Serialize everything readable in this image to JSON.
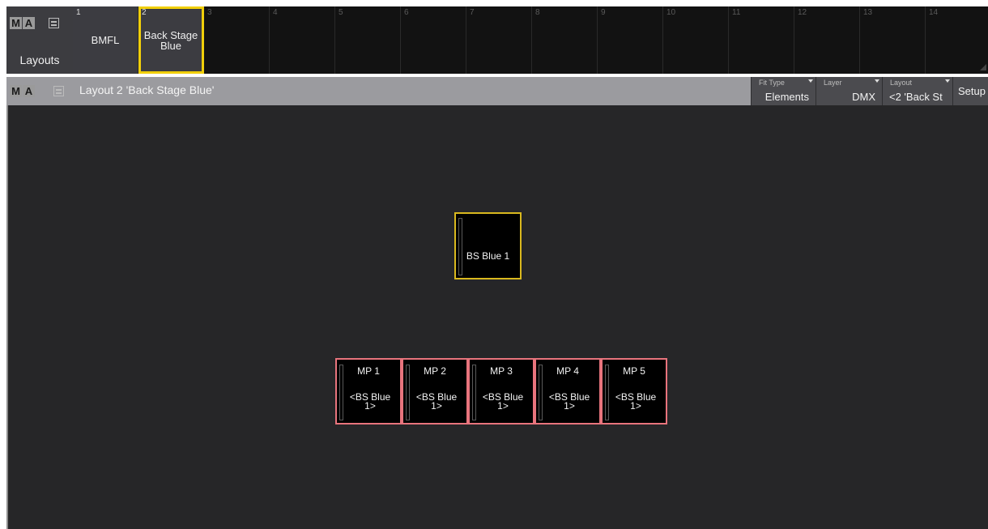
{
  "pool": {
    "title": "Layouts",
    "logo_letters": [
      "M",
      "A"
    ],
    "slots": [
      {
        "num": "1",
        "label": "BMFL"
      },
      {
        "num": "2",
        "label": "Back Stage\nBlue"
      },
      {
        "num": "3",
        "label": ""
      },
      {
        "num": "4",
        "label": ""
      },
      {
        "num": "5",
        "label": ""
      },
      {
        "num": "6",
        "label": ""
      },
      {
        "num": "7",
        "label": ""
      },
      {
        "num": "8",
        "label": ""
      },
      {
        "num": "9",
        "label": ""
      },
      {
        "num": "10",
        "label": ""
      },
      {
        "num": "11",
        "label": ""
      },
      {
        "num": "12",
        "label": ""
      },
      {
        "num": "13",
        "label": ""
      },
      {
        "num": "14",
        "label": ""
      }
    ],
    "selected_slot": "2"
  },
  "window": {
    "logo_letters": [
      "M",
      "A"
    ],
    "title": "Layout 2 'Back Stage Blue'",
    "header_buttons": [
      {
        "caption": "Fit Type",
        "value": "Elements"
      },
      {
        "caption": "Layer",
        "value": "DMX"
      },
      {
        "caption": "Layout",
        "value": "<2 'Back St"
      }
    ],
    "setup_label": "Setup"
  },
  "elements": {
    "main": {
      "name": "BS Blue 1"
    },
    "mps": [
      {
        "name": "MP 1",
        "sub": "<BS Blue\n1>"
      },
      {
        "name": "MP 2",
        "sub": "<BS Blue\n1>"
      },
      {
        "name": "MP 3",
        "sub": "<BS Blue\n1>"
      },
      {
        "name": "MP 4",
        "sub": "<BS Blue\n1>"
      },
      {
        "name": "MP 5",
        "sub": "<BS Blue\n1>"
      }
    ]
  },
  "colors": {
    "selected_outline": "#f1cf0a",
    "fixture_border": "#d9b81e",
    "multipatch_border": "#e8747d",
    "window_background": "#262628",
    "title_bar": "#9b9b9f"
  }
}
